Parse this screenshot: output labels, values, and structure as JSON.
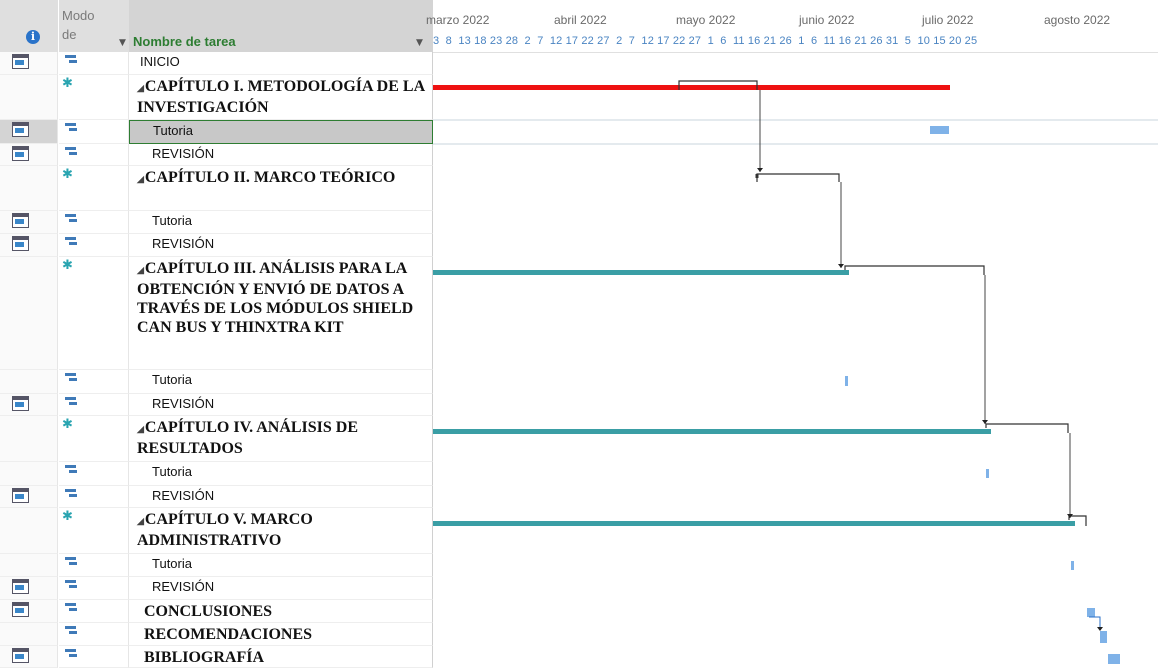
{
  "header": {
    "info_icon": "info-icon",
    "modo_line1": "Modo",
    "modo_line2": "de",
    "name_label": "Nombre de tarea"
  },
  "timeline": {
    "months": [
      "marzo 2022",
      "abril 2022",
      "mayo 2022",
      "junio 2022",
      "julio 2022",
      "agosto 2022"
    ],
    "days": "3  8  13 18 23 28  2  7  12 17 22 27  2  7  12 17 22 27  1  6  11 16 21 26  1  6  11 16 21 26 31  5  10 15 20 25"
  },
  "colors": {
    "critical": "#ee1111",
    "summary": "#3a9ea5",
    "task": "#7fb2e8",
    "link": "#444444"
  },
  "tasks": [
    {
      "indicator": "calendar-icon",
      "mode": "auto",
      "name": "INICIO",
      "style": "normal"
    },
    {
      "indicator": "",
      "mode": "manual",
      "name": "CAPÍTULO I. METODOLOGÍA DE LA INVESTIGACIÓN",
      "style": "summary"
    },
    {
      "indicator": "calendar-icon",
      "mode": "auto",
      "name": "Tutoria",
      "style": "normal"
    },
    {
      "indicator": "calendar-icon",
      "mode": "auto",
      "name": "REVISIÓN",
      "style": "normal"
    },
    {
      "indicator": "",
      "mode": "manual",
      "name": "CAPÍTULO II. MARCO TEÓRICO",
      "style": "summary"
    },
    {
      "indicator": "calendar-icon",
      "mode": "auto",
      "name": "Tutoria",
      "style": "normal"
    },
    {
      "indicator": "calendar-icon",
      "mode": "auto",
      "name": "REVISIÓN",
      "style": "normal"
    },
    {
      "indicator": "",
      "mode": "manual",
      "name": "CAPÍTULO III. ANÁLISIS PARA LA OBTENCIÓN Y ENVIÓ DE DATOS A TRAVÉS DE LOS MÓDULOS SHIELD CAN BUS Y THINXTRA KIT",
      "style": "summary"
    },
    {
      "indicator": "",
      "mode": "auto",
      "name": "Tutoria",
      "style": "normal"
    },
    {
      "indicator": "calendar-icon",
      "mode": "auto",
      "name": "REVISIÓN",
      "style": "normal"
    },
    {
      "indicator": "",
      "mode": "manual",
      "name": "CAPÍTULO IV. ANÁLISIS DE RESULTADOS",
      "style": "summary"
    },
    {
      "indicator": "",
      "mode": "auto",
      "name": "Tutoria",
      "style": "normal"
    },
    {
      "indicator": "calendar-icon",
      "mode": "auto",
      "name": "REVISIÓN",
      "style": "normal"
    },
    {
      "indicator": "",
      "mode": "manual",
      "name": "CAPÍTULO V. MARCO ADMINISTRATIVO",
      "style": "summary"
    },
    {
      "indicator": "",
      "mode": "auto",
      "name": "Tutoria",
      "style": "normal"
    },
    {
      "indicator": "calendar-icon",
      "mode": "auto",
      "name": "REVISIÓN",
      "style": "normal"
    },
    {
      "indicator": "calendar-icon",
      "mode": "auto",
      "name": "CONCLUSIONES",
      "style": "bold"
    },
    {
      "indicator": "",
      "mode": "auto",
      "name": "RECOMENDACIONES",
      "style": "bold"
    },
    {
      "indicator": "calendar-icon",
      "mode": "auto",
      "name": "BIBLIOGRAFÍA",
      "style": "bold"
    }
  ]
}
